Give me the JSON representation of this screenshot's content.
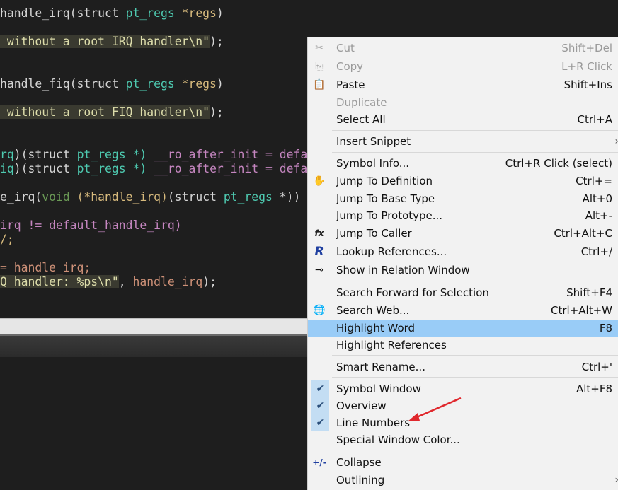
{
  "editor": {
    "lines": [
      [
        {
          "t": "handle_irq(struct ",
          "c": "c-fn"
        },
        {
          "t": "pt_regs ",
          "c": "c-type"
        },
        {
          "t": "*regs",
          "c": "c-ptr"
        },
        {
          "t": ")",
          "c": "c-fn"
        }
      ],
      [
        {
          "t": " without a root IRQ handler\\n\"",
          "c": "c-str"
        },
        {
          "t": ");",
          "c": "c-fn"
        }
      ],
      [
        {
          "t": "handle_fiq(struct ",
          "c": "c-fn"
        },
        {
          "t": "pt_regs ",
          "c": "c-type"
        },
        {
          "t": "*regs",
          "c": "c-ptr"
        },
        {
          "t": ")",
          "c": "c-fn"
        }
      ],
      [
        {
          "t": " without a root FIQ handler\\n\"",
          "c": "c-str"
        },
        {
          "t": ");",
          "c": "c-fn"
        }
      ],
      [
        {
          "t": "rq",
          "c": "c-grn"
        },
        {
          "t": ")(struct ",
          "c": "c-fn"
        },
        {
          "t": "pt_regs *) ",
          "c": "c-grn"
        },
        {
          "t": "__ro_after_init = defa",
          "c": "c-mac"
        }
      ],
      [
        {
          "t": "iq",
          "c": "c-grn"
        },
        {
          "t": ")(struct ",
          "c": "c-fn"
        },
        {
          "t": "pt_regs *) ",
          "c": "c-grn"
        },
        {
          "t": "__ro_after_init = defa",
          "c": "c-mac"
        }
      ],
      [
        {
          "t": "e_irq(",
          "c": "c-fn"
        },
        {
          "t": "void ",
          "c": "c-kw"
        },
        {
          "t": "(*handle_irq)",
          "c": "c-yel"
        },
        {
          "t": "(struct ",
          "c": "c-fn"
        },
        {
          "t": "pt_regs ",
          "c": "c-grn"
        },
        {
          "t": "*))",
          "c": "c-fn"
        }
      ],
      [
        {
          "t": "irq != default_handle_irq)",
          "c": "c-mac"
        }
      ],
      [
        {
          "t": "/;",
          "c": "c-yel"
        }
      ],
      [
        {
          "t": "= handle_irq;",
          "c": "c-org"
        }
      ],
      [
        {
          "t": "Q handler: %ps\\n\"",
          "c": "c-str"
        },
        {
          "t": ", ",
          "c": "c-fn"
        },
        {
          "t": "handle_irq",
          "c": "c-org"
        },
        {
          "t": ");",
          "c": "c-fn"
        }
      ]
    ]
  },
  "menu": {
    "items": [
      {
        "type": "item",
        "name": "menu-item-cut",
        "icon": "scissors-icon",
        "glyph": "✂",
        "label": "Cut",
        "shortcut": "Shift+Del",
        "disabled": true
      },
      {
        "type": "item",
        "name": "menu-item-copy",
        "icon": "copy-icon",
        "glyph": "⎘",
        "label": "Copy",
        "shortcut": "L+R Click",
        "disabled": true
      },
      {
        "type": "item",
        "name": "menu-item-paste",
        "icon": "paste-icon",
        "glyph": "📋",
        "label": "Paste",
        "shortcut": "Shift+Ins"
      },
      {
        "type": "item",
        "name": "menu-item-duplicate",
        "label": "Duplicate",
        "shortcut": "",
        "disabled": true
      },
      {
        "type": "item",
        "name": "menu-item-select-all",
        "label": "Select All",
        "shortcut": "Ctrl+A"
      },
      {
        "type": "sep"
      },
      {
        "type": "item",
        "name": "menu-item-insert-snippet",
        "label": "Insert Snippet",
        "shortcut": "",
        "submenu": true
      },
      {
        "type": "sep"
      },
      {
        "type": "item",
        "name": "menu-item-symbol-info",
        "label": "Symbol Info...",
        "shortcut": "Ctrl+R Click (select)"
      },
      {
        "type": "item",
        "name": "menu-item-jump-to-definition",
        "icon": "jump-definition-icon",
        "glyph": "✋",
        "label": "Jump To Definition",
        "shortcut": "Ctrl+="
      },
      {
        "type": "item",
        "name": "menu-item-jump-to-base-type",
        "label": "Jump To Base Type",
        "shortcut": "Alt+0"
      },
      {
        "type": "item",
        "name": "menu-item-jump-to-prototype",
        "label": "Jump To Prototype...",
        "shortcut": "Alt+-"
      },
      {
        "type": "item",
        "name": "menu-item-jump-to-caller",
        "icon": "jump-caller-icon",
        "glyph": "fx",
        "label": "Jump To Caller",
        "shortcut": "Ctrl+Alt+C"
      },
      {
        "type": "item",
        "name": "menu-item-lookup-references",
        "icon": "lookup-references-icon",
        "glyph": "R",
        "label": "Lookup References...",
        "shortcut": "Ctrl+/"
      },
      {
        "type": "item",
        "name": "menu-item-show-in-relation-window",
        "icon": "relation-tree-icon",
        "glyph": "⊸",
        "label": "Show in Relation Window",
        "shortcut": ""
      },
      {
        "type": "sep"
      },
      {
        "type": "item",
        "name": "menu-item-search-forward",
        "label": "Search Forward for Selection",
        "shortcut": "Shift+F4"
      },
      {
        "type": "item",
        "name": "menu-item-search-web",
        "icon": "web-search-icon",
        "glyph": "🌐",
        "label": "Search Web...",
        "shortcut": "Ctrl+Alt+W"
      },
      {
        "type": "item",
        "name": "menu-item-highlight-word",
        "label": "Highlight Word",
        "shortcut": "F8",
        "highlighted": true
      },
      {
        "type": "item",
        "name": "menu-item-highlight-references",
        "label": "Highlight References",
        "shortcut": ""
      },
      {
        "type": "sep"
      },
      {
        "type": "item",
        "name": "menu-item-smart-rename",
        "label": "Smart Rename...",
        "shortcut": "Ctrl+'"
      },
      {
        "type": "sep"
      },
      {
        "type": "item",
        "name": "menu-item-symbol-window",
        "label": "Symbol Window",
        "shortcut": "Alt+F8",
        "checked": true
      },
      {
        "type": "item",
        "name": "menu-item-overview",
        "label": "Overview",
        "shortcut": "",
        "checked": true
      },
      {
        "type": "item",
        "name": "menu-item-line-numbers",
        "label": "Line Numbers",
        "shortcut": "",
        "checked": true
      },
      {
        "type": "item",
        "name": "menu-item-special-window-color",
        "label": "Special Window Color...",
        "shortcut": ""
      },
      {
        "type": "sep"
      },
      {
        "type": "item",
        "name": "menu-item-collapse",
        "icon": "collapse-icon",
        "glyph": "+/-",
        "label": "Collapse",
        "shortcut": ""
      },
      {
        "type": "item",
        "name": "menu-item-outlining",
        "label": "Outlining",
        "shortcut": "",
        "submenu": true
      }
    ]
  },
  "colors": {
    "menu_highlight": "#99ccf7",
    "annotation_arrow": "#e0282d"
  }
}
